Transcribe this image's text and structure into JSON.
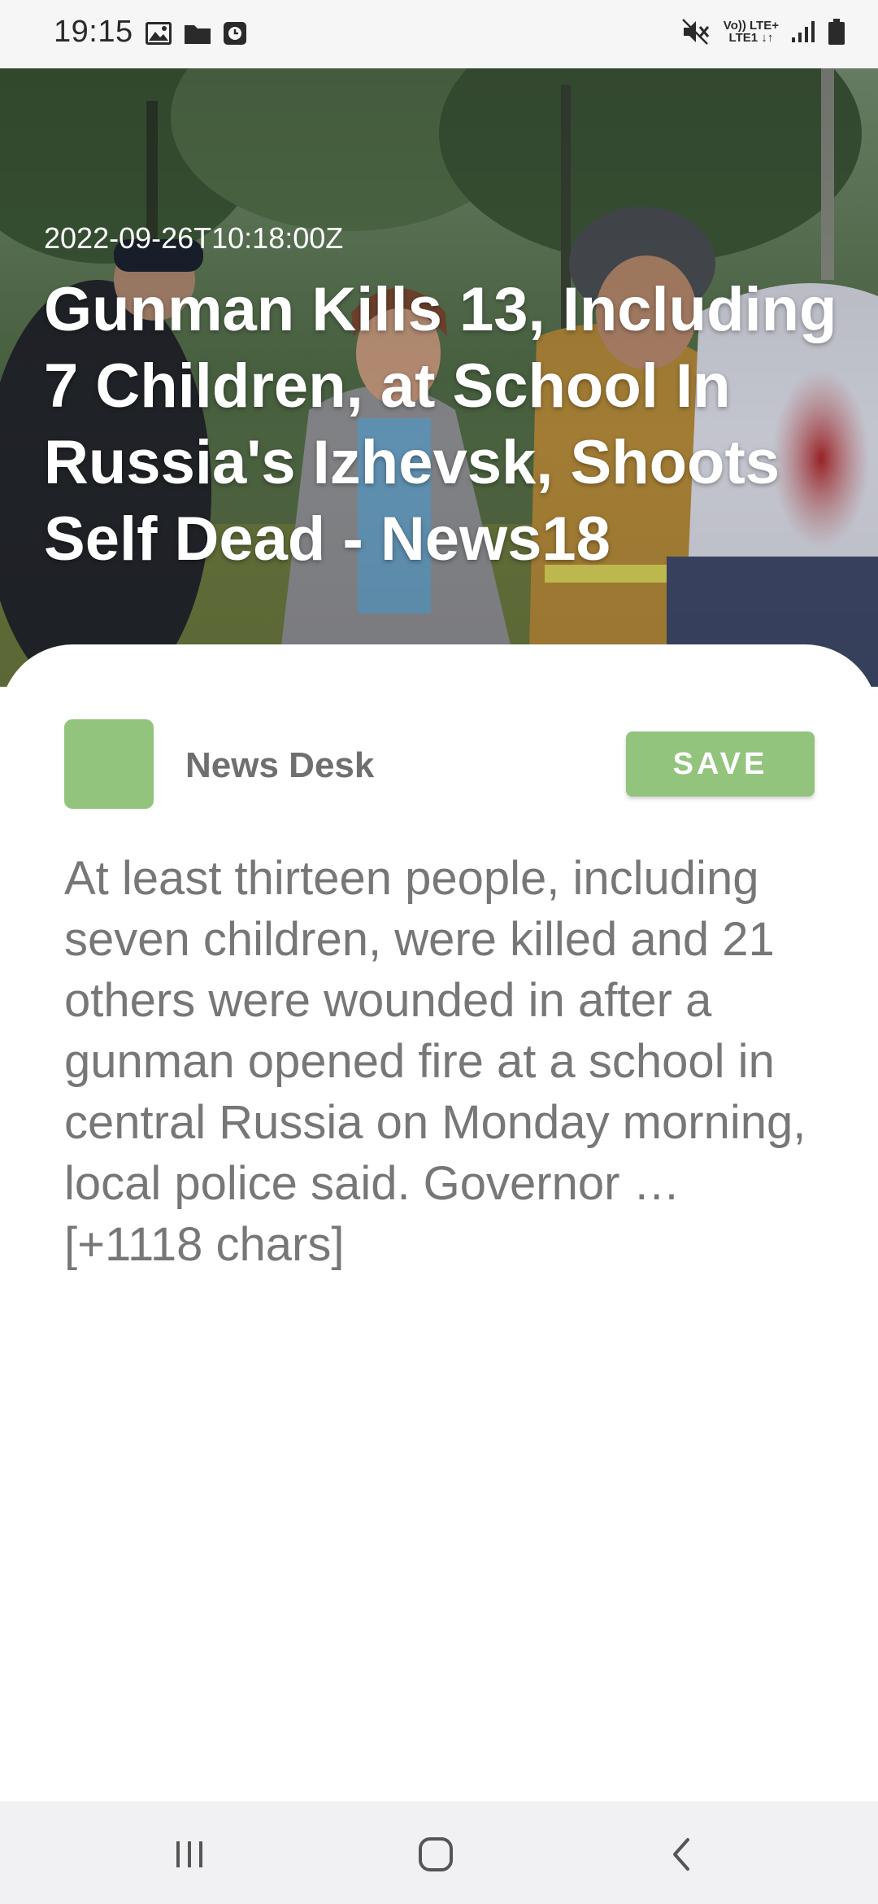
{
  "status_bar": {
    "time": "19:15",
    "left_icons": [
      "image-icon",
      "folder-icon",
      "clock-icon"
    ],
    "right_icons": [
      "mute-icon",
      "volte-icon",
      "signal-icon",
      "battery-icon"
    ],
    "volte_label_top": "Vo)) LTE+",
    "volte_label_bottom": "LTE1 ↓↑"
  },
  "article": {
    "published_at": "2022-09-26T10:18:00Z",
    "title": "Gunman Kills 13, Including 7 Children, at School In Russia's Izhevsk, Shoots Self Dead - News18",
    "author": "News Desk",
    "save_label": "SAVE",
    "body": "At least thirteen people, including seven children, were killed and 21 others were wounded in after a gunman opened fire at a school in central Russia on Monday morning, local police said. Governor … [+1118 chars]"
  },
  "nav_bar": {
    "buttons": [
      "recent-apps-icon",
      "home-icon",
      "back-icon"
    ]
  },
  "colors": {
    "accent": "#93c47d",
    "body_text": "#777777",
    "author_text": "#6f6f6f",
    "status_bar_bg": "#f6f6f7",
    "nav_bar_bg": "#f1f1f3"
  }
}
